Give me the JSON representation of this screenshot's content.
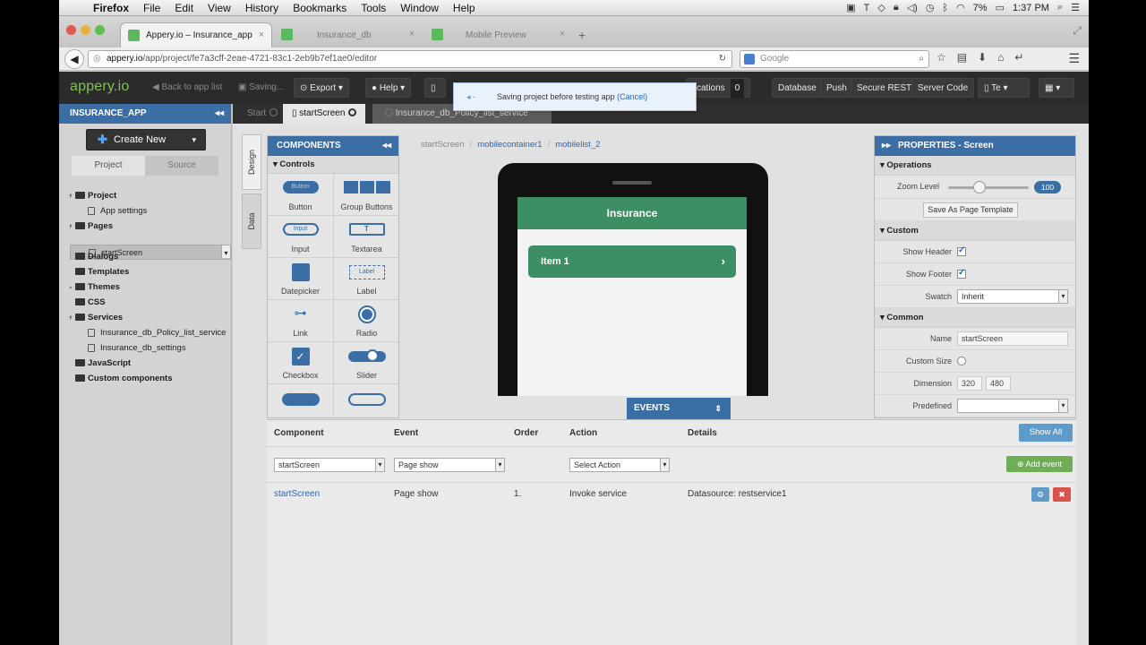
{
  "menubar": {
    "items": [
      "Firefox",
      "File",
      "Edit",
      "View",
      "History",
      "Bookmarks",
      "Tools",
      "Window",
      "Help"
    ],
    "battery": "7%",
    "time": "1:37 PM"
  },
  "browser": {
    "tabs": [
      {
        "label": "Appery.io – Insurance_app"
      },
      {
        "label": "Insurance_db"
      },
      {
        "label": "Mobile Preview"
      }
    ],
    "url_host": "appery.io",
    "url_path": "/app/project/fe7a3cff-2eae-4721-83c1-2eb9b7ef1ae0/editor",
    "search_placeholder": "Google"
  },
  "toolbar": {
    "logo": "appery.io",
    "back": "Back to app list",
    "saving": "Saving...",
    "export": "Export",
    "help": "Help",
    "notifications": "fications",
    "notif_count": "0",
    "database": "Database",
    "push": "Push",
    "secure_rest": "Secure REST",
    "server_code": "Server Code",
    "test": "Te"
  },
  "toast": {
    "message": "Saving project before testing app",
    "cancel": "(Cancel)"
  },
  "left": {
    "header": "INSURANCE_APP",
    "create_new": "Create New",
    "tabs": [
      "Project",
      "Source"
    ],
    "tree": [
      {
        "label": "Project",
        "level": 1
      },
      {
        "label": "App settings",
        "level": 2
      },
      {
        "label": "Pages",
        "level": 1
      },
      {
        "label": "startScreen",
        "level": 2
      },
      {
        "label": "Dialogs",
        "level": 1
      },
      {
        "label": "Templates",
        "level": 1
      },
      {
        "label": "Themes",
        "level": 1
      },
      {
        "label": "CSS",
        "level": 1
      },
      {
        "label": "Services",
        "level": 1
      },
      {
        "label": "Insurance_db_Policy_list_service",
        "level": 2
      },
      {
        "label": "Insurance_db_settings",
        "level": 2
      },
      {
        "label": "JavaScript",
        "level": 1
      },
      {
        "label": "Custom components",
        "level": 1
      }
    ]
  },
  "doctabs": [
    "Start",
    "startScreen",
    "Insurance_db_Policy_list_service"
  ],
  "vtabs": [
    "Design",
    "Data"
  ],
  "components": {
    "header": "COMPONENTS",
    "section": "Controls",
    "items": [
      "Button",
      "Group Buttons",
      "Input",
      "Textarea",
      "Datepicker",
      "Label",
      "Link",
      "Radio",
      "Checkbox",
      "Slider",
      "",
      ""
    ],
    "button_text": "Button",
    "input_text": "Input",
    "label_text": "Label"
  },
  "breadcrumb": [
    "startScreen",
    "mobilecontainer1",
    "mobilelist_2"
  ],
  "phone": {
    "header": "Insurance",
    "item": "Item 1"
  },
  "events_tab": "EVENTS",
  "properties": {
    "header": "PROPERTIES - Screen",
    "operations": "Operations",
    "zoom_label": "Zoom Level",
    "zoom_value": "100",
    "save_template": "Save As Page Template",
    "custom": "Custom",
    "show_header": "Show Header",
    "show_footer": "Show Footer",
    "swatch": "Swatch",
    "swatch_value": "Inherit",
    "common": "Common",
    "name_label": "Name",
    "name_value": "startScreen",
    "custom_size": "Custom Size",
    "dimension": "Dimension",
    "dim_w": "320",
    "dim_h": "480",
    "predefined": "Predefined"
  },
  "events": {
    "cols": [
      "Component",
      "Event",
      "Order",
      "Action",
      "Details"
    ],
    "show_all": "Show All",
    "sel_component": "startScreen",
    "sel_event": "Page show",
    "sel_action": "Select Action",
    "add_event": "Add event",
    "row": {
      "component": "startScreen",
      "event": "Page show",
      "order": "1.",
      "action": "Invoke service",
      "details": "Datasource: restservice1"
    }
  }
}
